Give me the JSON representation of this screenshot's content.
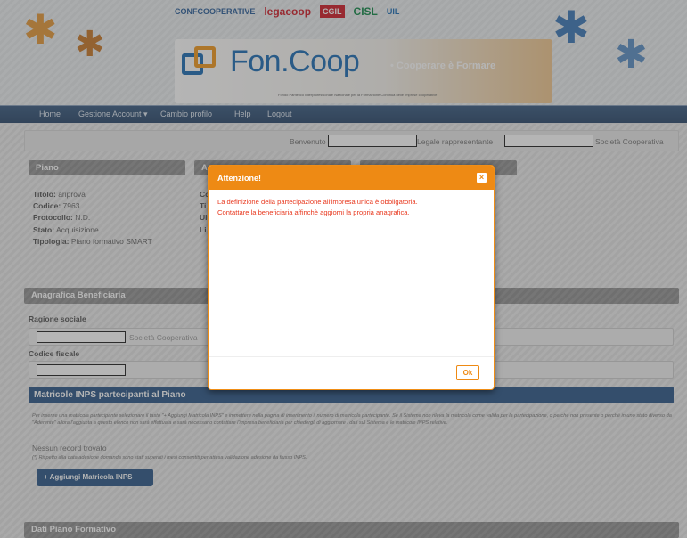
{
  "header": {
    "partner_logos": [
      "CONFCOOPERATIVE",
      "legacoop",
      "CGIL",
      "CISL",
      "UIL"
    ],
    "brand_name": "Fon.Coop",
    "brand_tagline": "• Cooperare è Formare",
    "brand_subtitle": "Fondo Paritetico Interprofessionale Nazionale per la Formazione Continua nelle Imprese cooperative"
  },
  "nav": {
    "home": "Home",
    "gestione": "Gestione Account ▾",
    "cambio": "Cambio profilo",
    "help": "Help",
    "logout": "Logout"
  },
  "welcome": {
    "benvenuto": "Benvenuto",
    "legale": "Legale rappresentante",
    "societa": "Società Cooperativa"
  },
  "piano": {
    "title": "Piano",
    "titolo_label": "Titolo:",
    "titolo_value": "ariprova",
    "codice_label": "Codice:",
    "codice_value": "7963",
    "protocollo_label": "Protocollo:",
    "protocollo_value": "N.D.",
    "stato_label": "Stato:",
    "stato_value": "Acquisizione",
    "tipologia_label": "Tipologia:",
    "tipologia_value": "Piano formativo SMART"
  },
  "second_panel": {
    "title_initial": "A",
    "rows": [
      "Co",
      "Ti",
      "Ul",
      "Li"
    ]
  },
  "anagrafica": {
    "title": "Anagrafica Beneficiaria",
    "ragione_label": "Ragione sociale",
    "ragione_suffix": "Società Cooperativa",
    "codice_label": "Codice fiscale"
  },
  "matricole": {
    "title": "Matricole INPS partecipanti al Piano",
    "description": "Per inserire una matricola partecipante selezionare il tasto \"+ Aggiungi Matricola INPS\" e immettere nella pagina di inserimento il numero di matricola partecipante. Se il Sistema non rileva la matricola come valida per la partecipazione, o perché non presente o perché in uno stato diverso da \"Aderente\" allora l'aggiunta a questo elenco non sarà effettuata e sarà necessario contattare l'impresa beneficiaria per chiedergli di aggiornare i dati sul Sistema e le matricole INPS relative.",
    "empty": "Nessun record trovato",
    "note": "(*) Rispetto alla data adesione domanda sono stati superati i mesi consentiti per attesa validazione adesione da flusso INPS.",
    "add_button": "+ Aggiungi Matricola INPS"
  },
  "dati_piano": {
    "title": "Dati Piano Formativo"
  },
  "modal": {
    "title": "Attenzione!",
    "close": "×",
    "line1": "La definizione della partecipazione all'impresa unica è obbligatoria.",
    "line2": "Contattare la beneficiaria affinchè aggiorni la propria anagrafica.",
    "ok": "Ok"
  },
  "colors": {
    "accent": "#ee8a14",
    "nav": "#2d4a6c",
    "primary": "#2f5a8a",
    "error_text": "#e8381e"
  }
}
